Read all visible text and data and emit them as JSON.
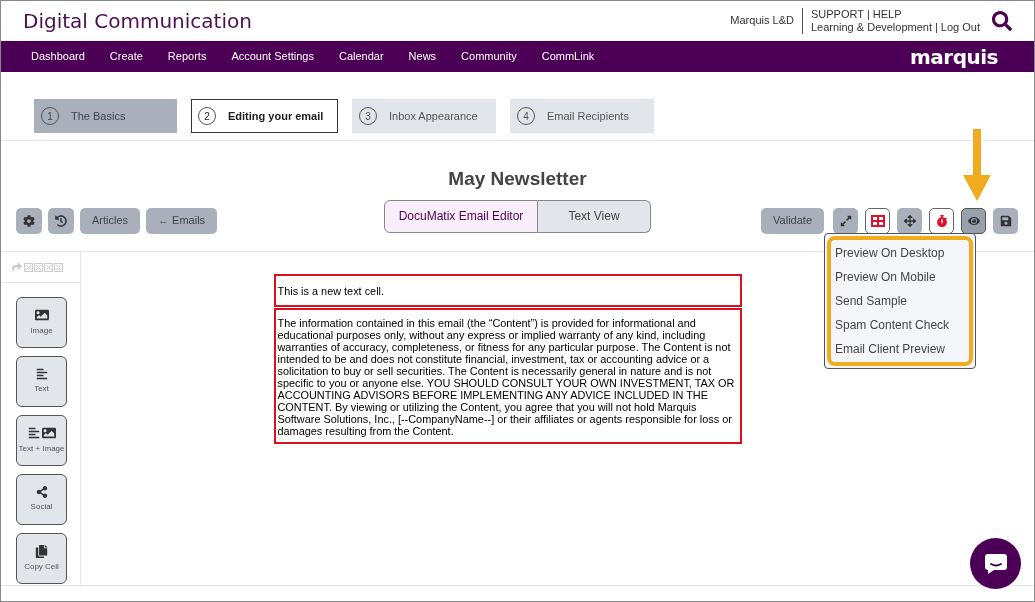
{
  "header": {
    "title": "Digital Communication",
    "account": "Marquis L&D",
    "links_top": [
      "SUPPORT",
      "|",
      "HELP"
    ],
    "links_bottom": [
      "Learning & Development",
      "|",
      "Log Out"
    ],
    "logo": "marquis"
  },
  "nav": [
    "Dashboard",
    "Create",
    "Reports",
    "Account Settings",
    "Calendar",
    "News",
    "Community",
    "CommLink"
  ],
  "steps": [
    {
      "number": "1",
      "label": "The Basics",
      "completed": true,
      "selected": false
    },
    {
      "number": "2",
      "label": "Editing your email",
      "completed": false,
      "selected": true
    },
    {
      "number": "3",
      "label": "Inbox Appearance",
      "completed": false,
      "selected": false
    },
    {
      "number": "4",
      "label": "Email Recipients",
      "completed": false,
      "selected": false
    }
  ],
  "editor": {
    "title": "May Newsletter",
    "left_buttons": [
      {
        "kind": "settings"
      },
      {
        "kind": "history"
      },
      {
        "kind": "text",
        "label": "Articles"
      },
      {
        "kind": "text",
        "label": "← Emails"
      }
    ],
    "views": [
      {
        "label": "DocuMatix Email Editor",
        "selected": true
      },
      {
        "label": "Text View",
        "selected": false
      }
    ],
    "right_buttons": [
      {
        "kind": "text",
        "label": "Validate",
        "active": false
      },
      {
        "kind": "expand",
        "active": false
      },
      {
        "kind": "grid",
        "active": false
      },
      {
        "kind": "move",
        "active": false
      },
      {
        "kind": "stopwatch",
        "active": false
      },
      {
        "kind": "eye",
        "active": true
      },
      {
        "kind": "save",
        "active": false
      }
    ],
    "preview_menu": [
      "Preview On Desktop",
      "Preview On Mobile",
      "Send Sample",
      "Spam Content Check",
      "Email Client Preview"
    ]
  },
  "blocks": [
    {
      "kind": "image",
      "label": "Image"
    },
    {
      "kind": "text",
      "label": "Text"
    },
    {
      "kind": "text_image",
      "label": "Text + Image"
    },
    {
      "kind": "social",
      "label": "Social"
    },
    {
      "kind": "copy",
      "label": "Copy Cell"
    }
  ],
  "cells": [
    "This is a new text cell.",
    "The information contained in this email (the “Content”) is provided for informational and educational purposes only, without any express or implied warranty of any kind, including warranties of accuracy, completeness, or fitness for any particular purpose. The Content is not intended to be and does not constitute financial, investment, tax or accounting advice or a solicitation to buy or sell securities. The Content is necessarily general in nature and is not specific to you or anyone else. YOU SHOULD CONSULT YOUR OWN INVESTMENT, TAX OR ACCOUNTING ADVISORS BEFORE IMPLEMENTING ANY ADVICE INCLUDED IN THE CONTENT. By viewing or utilizing the Content, you agree that you will not hold Marquis Software Solutions, Inc., [--CompanyName--] or their affiliates or agents responsible for loss or damages resulting from the Content."
  ]
}
